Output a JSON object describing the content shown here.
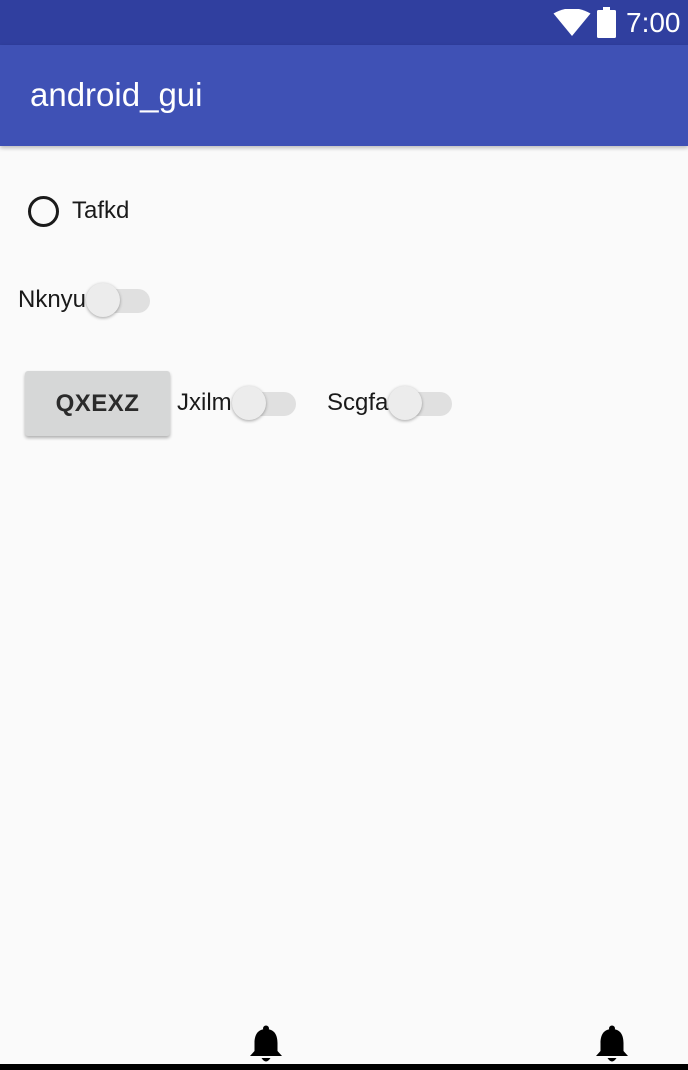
{
  "status_bar": {
    "time": "7:00",
    "icons": [
      "wifi-icon",
      "battery-icon"
    ]
  },
  "app_bar": {
    "title": "android_gui"
  },
  "radio": {
    "label": "Tafkd",
    "checked": false
  },
  "switch_1": {
    "label": "Nknyu",
    "on": false
  },
  "button": {
    "label": "QXEXZ"
  },
  "switch_2": {
    "label": "Jxilm",
    "on": false
  },
  "switch_3": {
    "label": "Scgfa",
    "on": false
  },
  "bottom_icons": [
    "bell-icon",
    "bell-icon"
  ],
  "colors": {
    "status_bar": "#303f9f",
    "app_bar": "#3f51b5",
    "background": "#fafafa",
    "button": "#d6d7d7"
  }
}
